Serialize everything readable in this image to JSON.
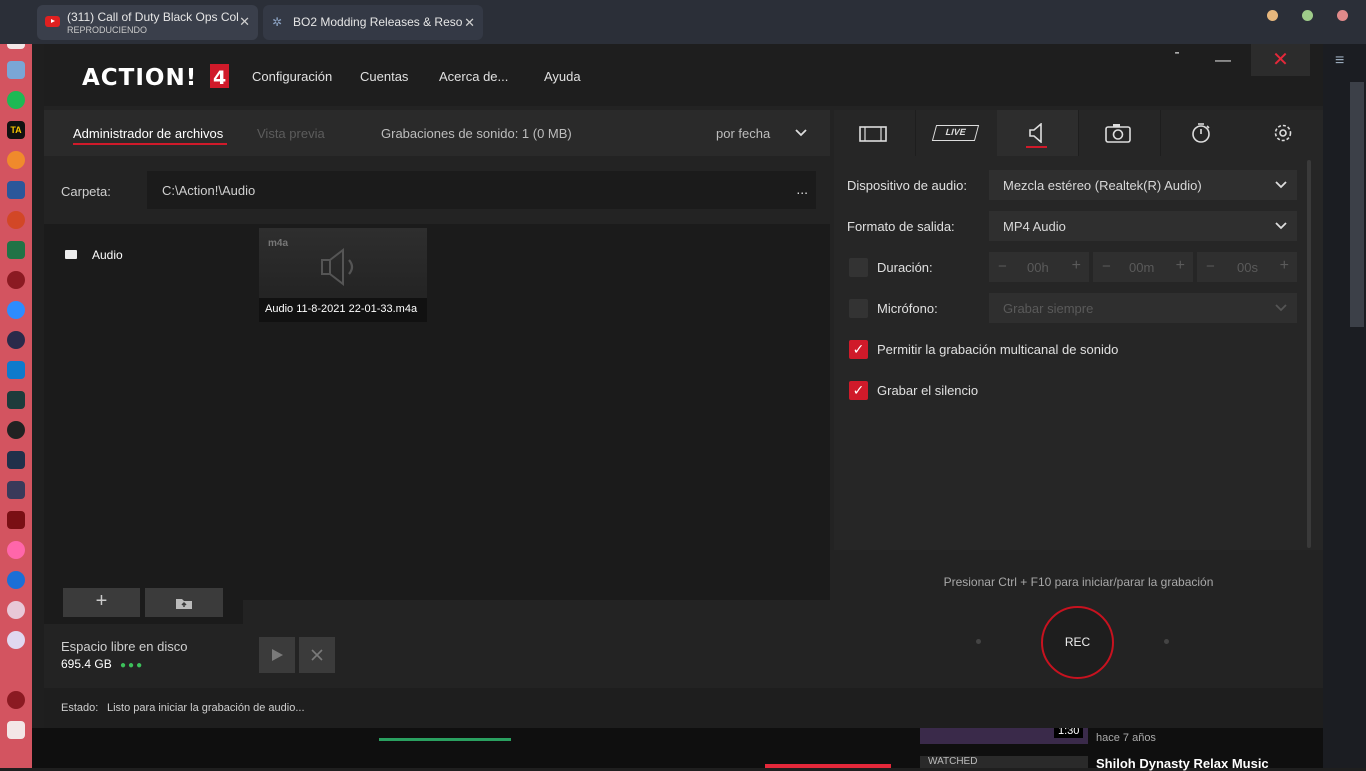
{
  "browser": {
    "tabs": [
      {
        "title": "(311) Call of Duty Black Ops Col",
        "subtitle": "REPRODUCIENDO",
        "close": "✕"
      },
      {
        "title": "BO2 Modding Releases & Reso",
        "close": "✕"
      }
    ],
    "window_dots": [
      "#e6b77d",
      "#9fcc8a",
      "#e08a8a"
    ],
    "menu_icon": "≡"
  },
  "app": {
    "logo": "ACTION! 4",
    "menu": [
      "Configuración",
      "Cuentas",
      "Acerca de...",
      "Ayuda"
    ],
    "window_controls": {
      "minimize": "-",
      "maximize": "—",
      "close": "✕"
    },
    "toolbar": {
      "file_manager": "Administrador de archivos",
      "preview": "Vista previa",
      "recordings": "Grabaciones de sonido: 1 (0 MB)",
      "sort": "por fecha"
    },
    "folder": {
      "label": "Carpeta:",
      "path": "C:\\Action!\\Audio",
      "more": "..."
    },
    "sidebar": {
      "items": [
        {
          "label": "Audio"
        }
      ],
      "add": "+",
      "disk_label": "Espacio libre en disco",
      "disk_value": "695.4 GB"
    },
    "files": [
      {
        "type": "m4a",
        "name": "Audio 11-8-2021 22-01-33.m4a"
      }
    ],
    "rec_tabs": [
      "video-icon",
      "live-icon",
      "audio-icon",
      "camera-icon",
      "timer-icon",
      "settings-icon"
    ],
    "live_label": "LIVE",
    "audio_settings": {
      "device_label": "Dispositivo de audio:",
      "device_value": "Mezcla estéreo (Realtek(R) Audio)",
      "format_label": "Formato de salida:",
      "format_value": "MP4 Audio",
      "duration_label": "Duración:",
      "duration_h": "00h",
      "duration_m": "00m",
      "duration_s": "00s",
      "mic_label": "Micrófono:",
      "mic_value": "Grabar siempre",
      "multichannel_label": "Permitir la grabación multicanal de sonido",
      "silence_label": "Grabar el silencio"
    },
    "hint": "Presionar Ctrl + F10 para iniciar/parar la grabación",
    "rec": "REC",
    "status_label": "Estado:",
    "status_value": "Listo para iniciar la grabación de audio...",
    "accent": "#d01a2a"
  },
  "background": {
    "video_time": "1:30",
    "ago": "hace 7 años",
    "watched": "WATCHED",
    "next_title": "Shiloh Dynasty Relax Music"
  }
}
